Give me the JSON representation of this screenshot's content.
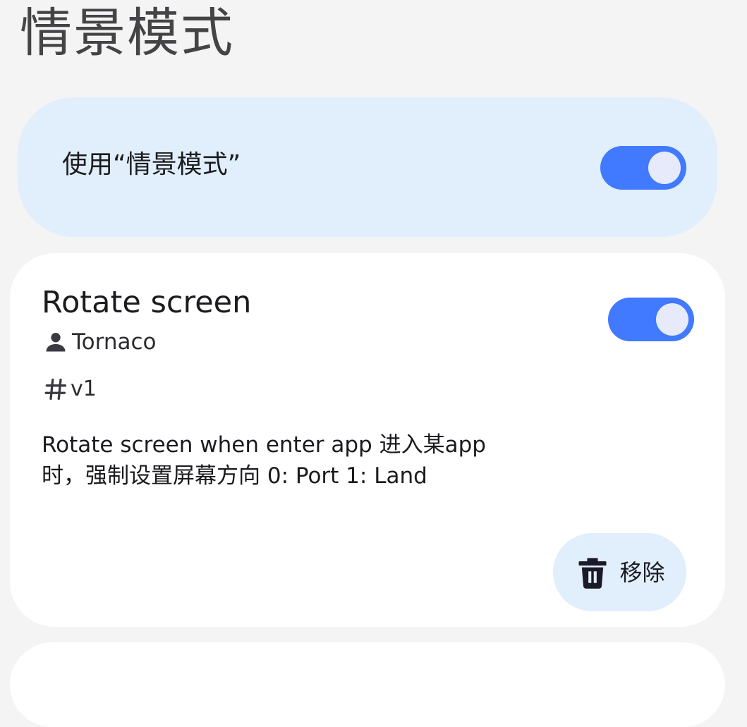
{
  "page": {
    "title": "情景模式"
  },
  "master_toggle": {
    "label": "使用“情景模式”",
    "enabled": true
  },
  "rules": [
    {
      "title": "Rotate screen",
      "author": "Tornaco",
      "version": "v1",
      "description": "Rotate screen when enter app 进入某app\n时，强制设置屏幕方向 0: Port 1: Land",
      "enabled": true,
      "remove_label": "移除"
    }
  ],
  "icons": {
    "author": "person-icon",
    "version": "hash-icon",
    "remove": "trash-icon"
  },
  "colors": {
    "accent": "#4179ff",
    "card_tint": "#e1eefc",
    "background": "#f4f4f4"
  }
}
